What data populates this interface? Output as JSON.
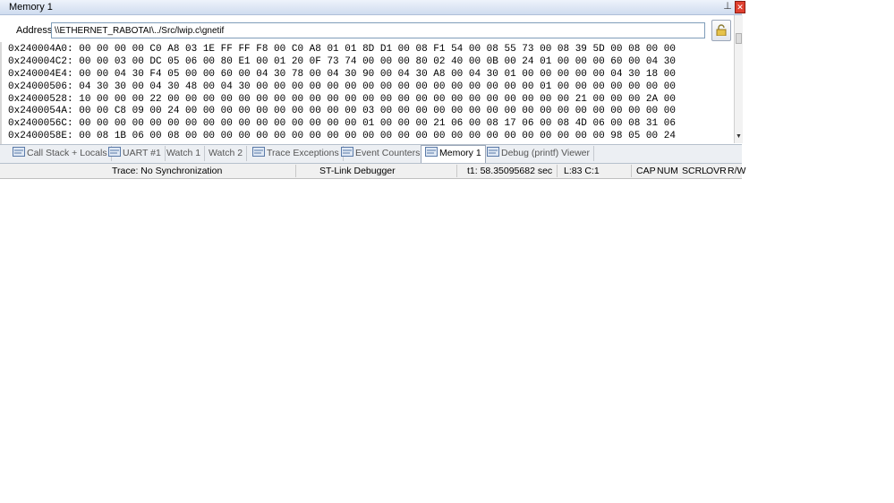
{
  "window": {
    "title": "Memory 1",
    "pin_glyph": "⊥",
    "close_glyph": "✕"
  },
  "address": {
    "label": "Address:",
    "value": "\\\\ETHERNET_RABOTAI\\../Src/lwip.c\\gnetif"
  },
  "memory": {
    "rows": [
      "0x240004A0: 00 00 00 00 C0 A8 03 1E FF FF F8 00 C0 A8 01 01 8D D1 00 08 F1 54 00 08 55 73 00 08 39 5D 00 08 00 00",
      "0x240004C2: 00 00 03 00 DC 05 06 00 80 E1 00 01 20 0F 73 74 00 00 00 80 02 40 00 0B 00 24 01 00 00 00 60 00 04 30",
      "0x240004E4: 00 00 04 30 F4 05 00 00 60 00 04 30 78 00 04 30 90 00 04 30 A8 00 04 30 01 00 00 00 00 00 04 30 18 00",
      "0x24000506: 04 30 30 00 04 30 48 00 04 30 00 00 00 00 00 00 00 00 00 00 00 00 00 00 00 00 01 00 00 00 00 00 00 00",
      "0x24000528: 10 00 00 00 22 00 00 00 00 00 00 00 00 00 00 00 00 00 00 00 00 00 00 00 00 00 00 00 21 00 00 00 2A 00",
      "0x2400054A: 00 00 C8 09 00 24 00 00 00 00 00 00 00 00 00 00 03 00 00 00 00 00 00 00 00 00 00 00 00 00 00 00 00 00",
      "0x2400056C: 00 00 00 00 00 00 00 00 00 00 00 00 00 00 00 00 01 00 00 00 21 06 00 08 17 06 00 08 4D 06 00 08 31 06",
      "0x2400058E: 00 08 1B 06 00 08 00 00 00 00 00 00 00 00 00 00 00 00 00 00 00 00 00 00 00 00 00 00 00 00 98 05 00 24"
    ]
  },
  "tabs": [
    {
      "label": "Call Stack + Locals",
      "icon": "call-stack-icon",
      "active": false
    },
    {
      "label": "UART #1",
      "icon": "uart-icon",
      "active": false
    },
    {
      "label": "Watch 1",
      "icon": "",
      "active": false
    },
    {
      "label": "Watch 2",
      "icon": "",
      "active": false
    },
    {
      "label": "Trace Exceptions",
      "icon": "trace-icon",
      "active": false
    },
    {
      "label": "Event Counters",
      "icon": "counters-icon",
      "active": false
    },
    {
      "label": "Memory 1",
      "icon": "memory-icon",
      "active": true
    },
    {
      "label": "Debug (printf) Viewer",
      "icon": "debug-viewer-icon",
      "active": false
    }
  ],
  "status": {
    "trace": "Trace: No Synchronization",
    "debugger": "ST-Link Debugger",
    "time": "t1: 58.35095682 sec",
    "position": "L:83 C:1",
    "caps": "CAP",
    "num": "NUM",
    "scrl": "SCRL",
    "ovr": "OVR",
    "rw": "R/W"
  },
  "colors": {
    "active_tab_bg": "#ffffff",
    "close_red": "#e04030"
  }
}
